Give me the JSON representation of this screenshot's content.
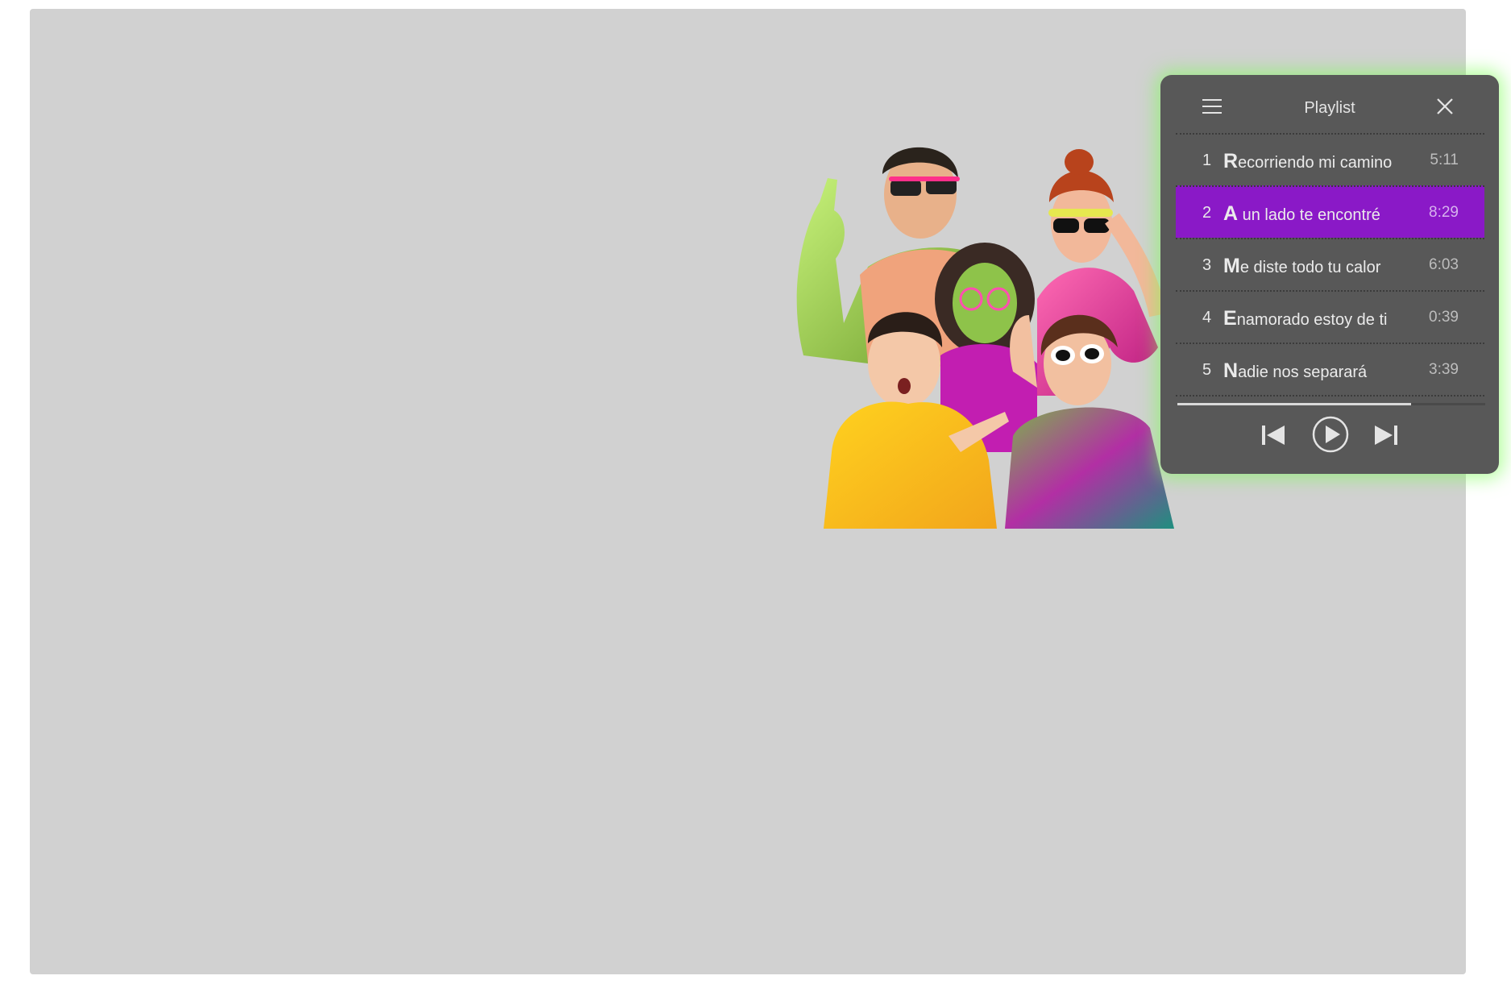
{
  "player": {
    "title": "Playlist",
    "progress_fraction": 0.76,
    "tracks": [
      {
        "number": "1",
        "title": "Recorriendo mi camino",
        "duration": "5:11",
        "active": false
      },
      {
        "number": "2",
        "title": "A un lado te encontré",
        "duration": "8:29",
        "active": true
      },
      {
        "number": "3",
        "title": "Me diste todo tu calor",
        "duration": "6:03",
        "active": false
      },
      {
        "number": "4",
        "title": "Enamorado estoy de ti",
        "duration": "0:39",
        "active": false
      },
      {
        "number": "5",
        "title": "Nadie nos separará",
        "duration": "3:39",
        "active": false
      }
    ]
  },
  "colors": {
    "stage_background": "#d1d1d1",
    "panel_background": "#585858",
    "active_track": "#8a19c7",
    "panel_glow": "#78ff50"
  },
  "icons": [
    "menu-icon",
    "close-icon",
    "skip-previous-icon",
    "play-icon",
    "skip-next-icon"
  ]
}
